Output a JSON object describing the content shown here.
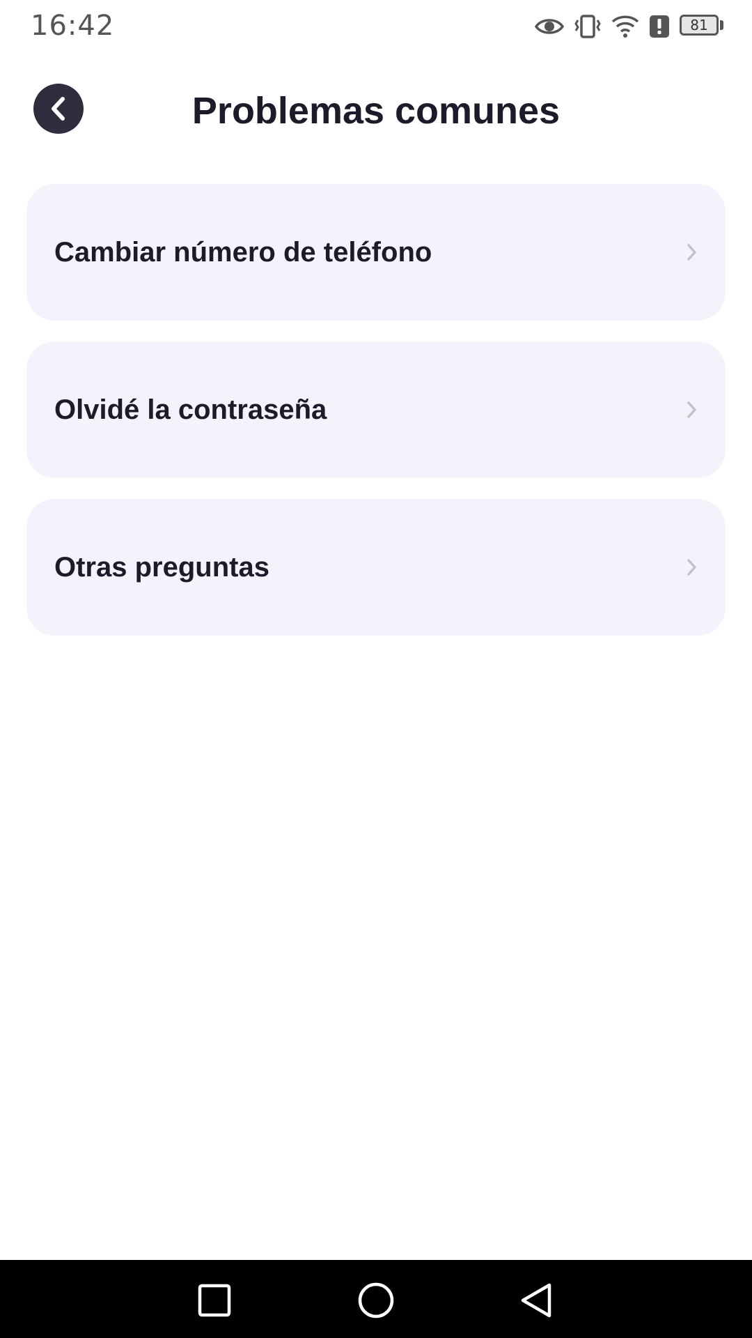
{
  "status_bar": {
    "time": "16:42",
    "icons": [
      "eye-icon",
      "vibrate-icon",
      "wifi-icon",
      "alert-icon",
      "battery-icon"
    ],
    "battery_level": "81"
  },
  "header": {
    "back_icon": "chevron-left-icon",
    "title": "Problemas comunes"
  },
  "menu": {
    "items": [
      {
        "label": "Cambiar número de teléfono"
      },
      {
        "label": "Olvidé la contraseña"
      },
      {
        "label": "Otras preguntas"
      }
    ]
  },
  "nav_bar": {
    "buttons": [
      "recents-square-icon",
      "home-circle-icon",
      "back-triangle-icon"
    ]
  },
  "colors": {
    "background": "#ffffff",
    "card": "#f3f3fc",
    "text": "#1c1b2a",
    "back_button": "#2f2e3f",
    "chevron": "#c2c2cc",
    "nav_bar": "#000000"
  }
}
